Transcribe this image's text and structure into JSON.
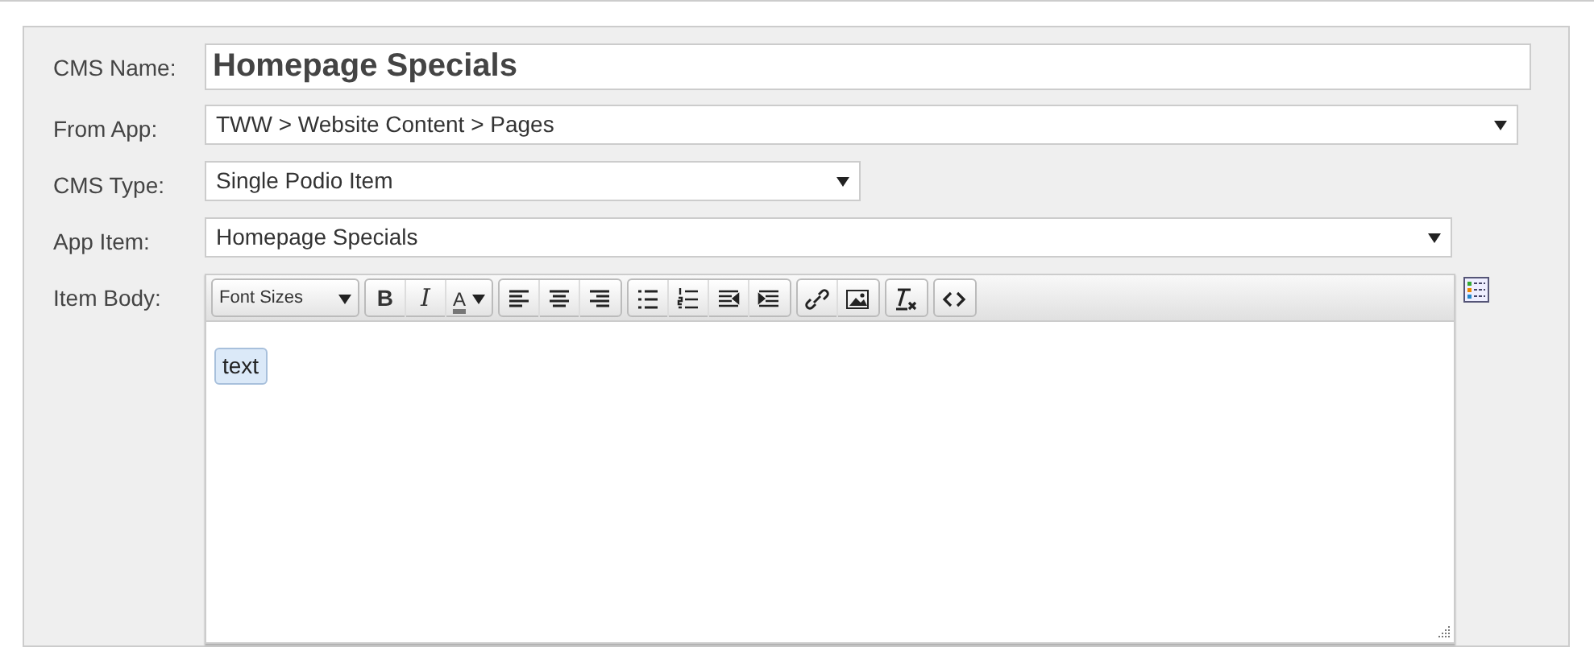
{
  "fields": [
    {
      "label": "CMS Name:",
      "kind": "text",
      "value": "Homepage Specials"
    },
    {
      "label": "From App:",
      "kind": "select",
      "value": "TWW > Website Content > Pages"
    },
    {
      "label": "CMS Type:",
      "kind": "select",
      "value": "Single Podio Item"
    },
    {
      "label": "App Item:",
      "kind": "select",
      "value": "Homepage Specials"
    },
    {
      "label": "Item Body:",
      "kind": "editor",
      "content": "text",
      "toolbar": [
        [
          {
            "kind": "dropdown",
            "label": "Font Sizes"
          }
        ],
        [
          {
            "kind": "bold",
            "label": "B"
          },
          {
            "kind": "italic",
            "label": "I"
          },
          {
            "kind": "color",
            "label": "A"
          }
        ],
        [
          {
            "kind": "align-left"
          },
          {
            "kind": "align-center"
          },
          {
            "kind": "align-right"
          }
        ],
        [
          {
            "kind": "bullets"
          },
          {
            "kind": "numbers"
          },
          {
            "kind": "outdent"
          },
          {
            "kind": "indent"
          }
        ],
        [
          {
            "kind": "link"
          },
          {
            "kind": "image"
          }
        ],
        [
          {
            "kind": "clear-format"
          }
        ],
        [
          {
            "kind": "code"
          }
        ]
      ]
    }
  ]
}
